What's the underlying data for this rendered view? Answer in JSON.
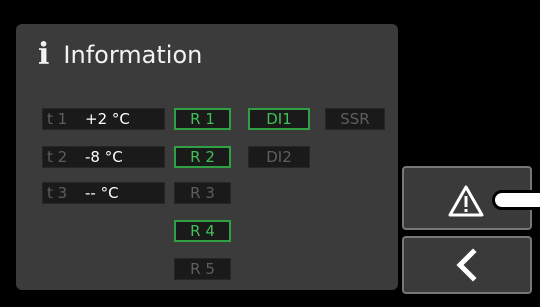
{
  "header": {
    "icon": "info-icon",
    "icon_glyph": "i",
    "title": "Information"
  },
  "sensors": [
    {
      "label": "t 1",
      "value": "+2 °C"
    },
    {
      "label": "t 2",
      "value": "-8 °C"
    },
    {
      "label": "t 3",
      "value": "-- °C"
    }
  ],
  "relays": [
    {
      "label": "R 1",
      "active": true
    },
    {
      "label": "R 2",
      "active": true
    },
    {
      "label": "R 3",
      "active": false
    },
    {
      "label": "R 4",
      "active": true
    },
    {
      "label": "R 5",
      "active": false
    }
  ],
  "digital_inputs": [
    {
      "label": "DI1",
      "active": true
    },
    {
      "label": "DI2",
      "active": false
    }
  ],
  "ssr": {
    "label": "SSR",
    "active": false
  },
  "side_buttons": {
    "alarm_icon": "warning-triangle-icon",
    "back_icon": "chevron-left-icon"
  },
  "colors": {
    "active_border": "#2fa043",
    "active_text": "#3fbf55",
    "panel": "#3b3b3b"
  }
}
